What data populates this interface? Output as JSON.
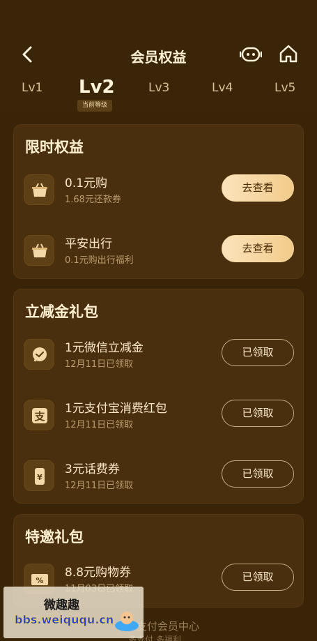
{
  "header": {
    "title": "会员权益"
  },
  "levels": {
    "items": [
      "Lv1",
      "Lv2",
      "Lv3",
      "Lv4",
      "Lv5"
    ],
    "current": "Lv2",
    "current_badge": "当前等级"
  },
  "limited": {
    "title": "限时权益",
    "items": [
      {
        "title": "0.1元购",
        "sub": "1.68元还款券",
        "button": "去查看",
        "icon": "basket-icon"
      },
      {
        "title": "平安出行",
        "sub": "0.1元购出行福利",
        "button": "去查看",
        "icon": "basket-icon"
      }
    ]
  },
  "discount": {
    "title": "立减金礼包",
    "items": [
      {
        "title": "1元微信立减金",
        "sub": "12月11日已领取",
        "button": "已领取",
        "icon": "wechat-icon"
      },
      {
        "title": "1元支付宝消费红包",
        "sub": "12月11日已领取",
        "button": "已领取",
        "icon": "alipay-icon"
      },
      {
        "title": "3元话费券",
        "sub": "12月11日已领取",
        "button": "已领取",
        "icon": "phone-yen-icon"
      }
    ]
  },
  "special": {
    "title": "特邀礼包",
    "items": [
      {
        "title": "8.8元购物券",
        "sub": "11月03日已领取",
        "button": "已领取",
        "icon": "coupon-icon"
      }
    ]
  },
  "footer": {
    "text": "支付会员中心",
    "sub": "多支付 多福利"
  },
  "watermark": {
    "title": "微趣趣",
    "url": "bbs.weiququ.cn"
  },
  "colors": {
    "background": "#3a2408",
    "card": "#4a2f0e",
    "gold_button": "#f2cb8a"
  }
}
